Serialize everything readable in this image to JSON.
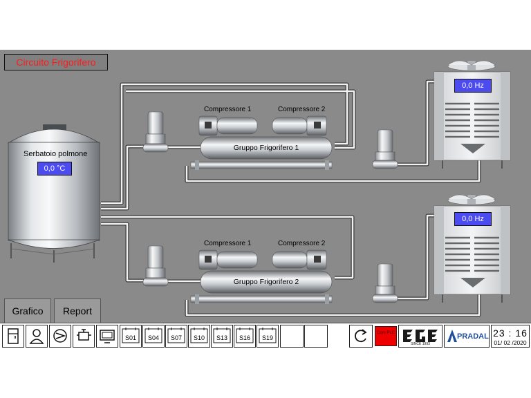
{
  "title": "Circuito Frigorifero",
  "tank": {
    "label": "Serbatoio polmone",
    "temperature": "0,0 °C"
  },
  "groups": [
    {
      "label": "Gruppo Frigorifero 1",
      "compressors": [
        "Compressore 1",
        "Compressore 2"
      ],
      "cooler_frequency": "0,0 Hz"
    },
    {
      "label": "Gruppo Frigorifero 2",
      "compressors": [
        "Compressore 1",
        "Compressore 2"
      ],
      "cooler_frequency": "0,0 Hz"
    }
  ],
  "buttons": {
    "chart": "Grafico",
    "report": "Report"
  },
  "toolbar": {
    "schedules": [
      "S01",
      "S04",
      "S07",
      "S10",
      "S13",
      "S16",
      "S19"
    ],
    "plc_status": "Com PLC",
    "logo_pradal": "PRADAL",
    "logo_ege_since": "SINCE 1993"
  },
  "clock": {
    "time": "23 : 16",
    "date": "01/ 02 /2020"
  },
  "colors": {
    "background": "#8a8a8a",
    "readout": "#4b4bf0",
    "title_text": "#ff1a1a",
    "plc_alarm": "#ee0000"
  }
}
